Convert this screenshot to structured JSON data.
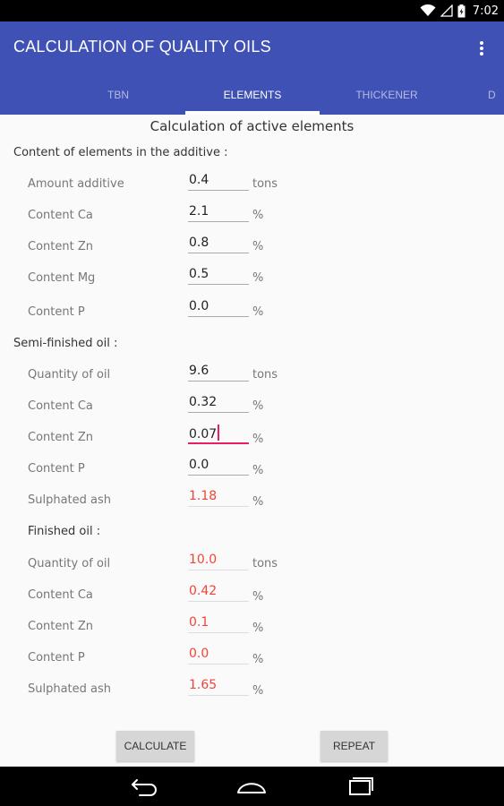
{
  "status": {
    "time": "7:02",
    "icons": [
      "wifi-icon",
      "signal-icon",
      "battery-icon"
    ]
  },
  "app_bar": {
    "title": "CALCULATION OF QUALITY OILS",
    "menu_icon": "more-vert-icon",
    "color": "#3f51b5"
  },
  "tabs": [
    {
      "label": "TBN",
      "active": false
    },
    {
      "label": "ELEMENTS",
      "active": true
    },
    {
      "label": "THICKENER",
      "active": false
    },
    {
      "label": "D",
      "active": false
    }
  ],
  "heading": "Calculation of active elements",
  "additive": {
    "title": "Content of elements in the additive :",
    "rows": [
      {
        "label": "Amount additive",
        "value": "0.4",
        "unit": "tons"
      },
      {
        "label": "Content Ca",
        "value": "2.1",
        "unit": "%"
      },
      {
        "label": "Content Zn",
        "value": "0.8",
        "unit": "%"
      },
      {
        "label": "Content Mg",
        "value": "0.5",
        "unit": "%"
      },
      {
        "label": "Content P",
        "value": "0.0",
        "unit": "%"
      }
    ]
  },
  "semi_finished": {
    "title": "Semi-finished oil :",
    "rows": [
      {
        "label": "Quantity of oil",
        "value": "9.6",
        "unit": "tons"
      },
      {
        "label": "Content Ca",
        "value": "0.32",
        "unit": "%"
      },
      {
        "label": "Content Zn",
        "value": "0.07",
        "unit": "%"
      },
      {
        "label": "Content P",
        "value": "0.0",
        "unit": "%"
      },
      {
        "label": "Sulphated ash",
        "value": "1.18",
        "unit": "%"
      }
    ]
  },
  "finished": {
    "title": "Finished oil :",
    "rows": [
      {
        "label": "Quantity of oil",
        "value": "10.0",
        "unit": "tons"
      },
      {
        "label": "Content Ca",
        "value": "0.42",
        "unit": "%"
      },
      {
        "label": "Content Zn",
        "value": "0.1",
        "unit": "%"
      },
      {
        "label": "Content P",
        "value": "0.0",
        "unit": "%"
      },
      {
        "label": "Sulphated ash",
        "value": "1.65",
        "unit": "%"
      }
    ]
  },
  "buttons": {
    "calculate": "CALCULATE",
    "repeat": "REPEAT"
  },
  "colors": {
    "result_text": "#f44336",
    "focus_underline": "#e91e63"
  }
}
